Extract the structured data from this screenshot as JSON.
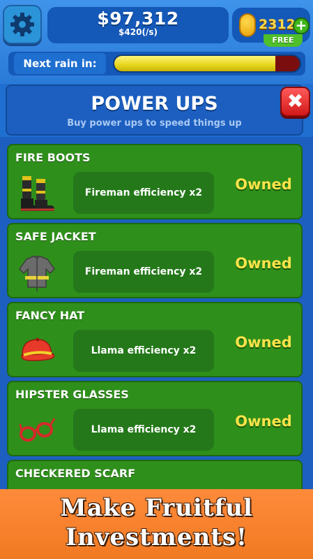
{
  "top_bar": {
    "money": "$97,312",
    "money_rate": "$420(/s)",
    "coins": "2312",
    "plus_symbol": "+",
    "free_label": "FREE",
    "rain_label": "Next rain in:",
    "rain_progress": 0.87
  },
  "panel": {
    "title": "POWER UPS",
    "subtitle": "Buy power ups to speed things up",
    "close_symbol": "✖"
  },
  "items": [
    {
      "name": "FIRE BOOTS",
      "effect": "Fireman efficiency x2",
      "status": "Owned",
      "icon": "fire-boots-icon"
    },
    {
      "name": "SAFE JACKET",
      "effect": "Fireman efficiency x2",
      "status": "Owned",
      "icon": "safe-jacket-icon"
    },
    {
      "name": "FANCY HAT",
      "effect": "Llama efficiency x2",
      "status": "Owned",
      "icon": "fancy-hat-icon"
    },
    {
      "name": "HIPSTER GLASSES",
      "effect": "Llama efficiency x2",
      "status": "Owned",
      "icon": "hipster-glasses-icon"
    },
    {
      "name": "CHECKERED SCARF"
    }
  ],
  "promo": {
    "line1": "Make Fruitful",
    "line2": "Investments!"
  },
  "colors": {
    "background_blue": "#1f6fd0",
    "card_green": "#2f8f1b",
    "owned_yellow": "#fbe34a",
    "close_red": "#d21919",
    "promo_orange": "#f07a22"
  }
}
